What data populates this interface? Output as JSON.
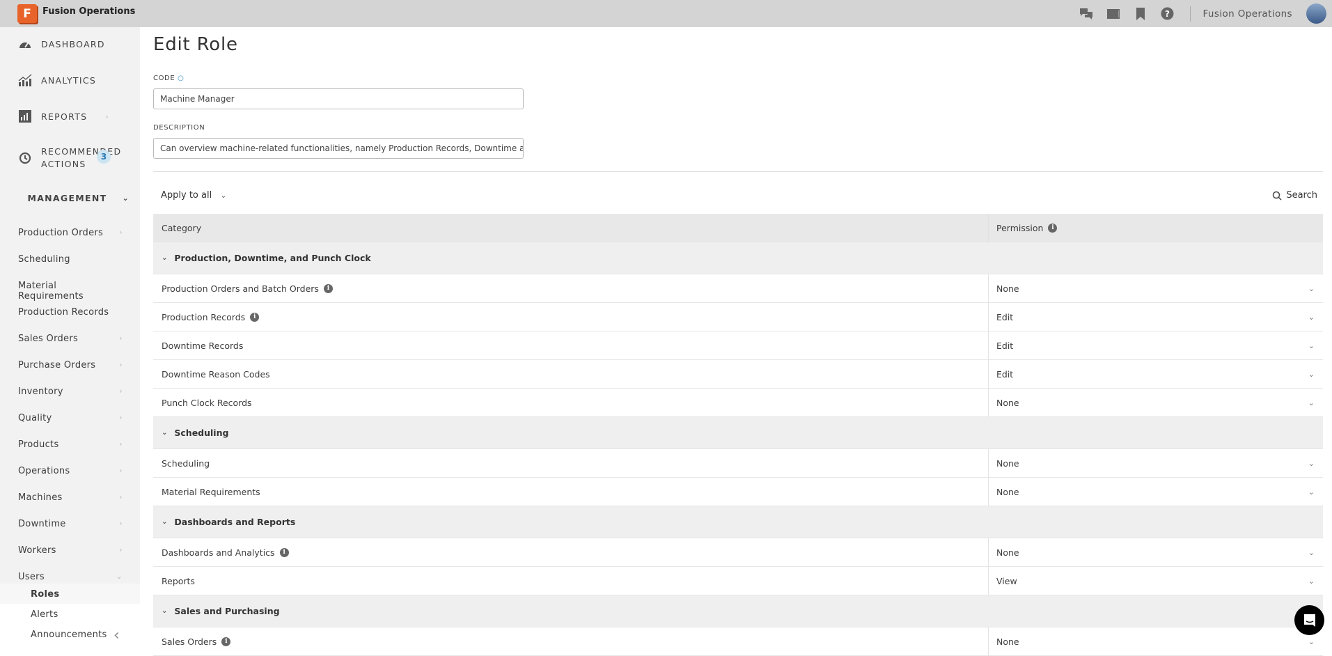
{
  "app": {
    "name": "Fusion Operations",
    "logo_letter": "F",
    "user_org": "Fusion Operations"
  },
  "topbar_icons": [
    "chat-icon",
    "tablet-icon",
    "bookmark-icon",
    "help-icon"
  ],
  "sidebar": {
    "main": [
      {
        "label": "DASHBOARD"
      },
      {
        "label": "ANALYTICS"
      },
      {
        "label": "REPORTS"
      },
      {
        "label": "RECOMMENDED",
        "label2": "ACTIONS",
        "badge": "3"
      },
      {
        "label": "MANAGEMENT"
      }
    ],
    "sub": [
      "Production Orders",
      "Scheduling",
      "Material Requirements",
      "Production Records",
      "Sales Orders",
      "Purchase Orders",
      "Inventory",
      "Quality",
      "Products",
      "Operations",
      "Machines",
      "Downtime",
      "Workers",
      "Users"
    ],
    "users_sub": [
      "Roles",
      "Alerts",
      "Announcements"
    ]
  },
  "page": {
    "title": "Edit Role",
    "code_label": "CODE",
    "code_value": "Machine Manager",
    "description_label": "DESCRIPTION",
    "description_value": "Can overview machine-related functionalities, namely Production Records, Downtime and Maintenance",
    "apply_to_all": "Apply to all",
    "search": "Search"
  },
  "table": {
    "headers": {
      "category": "Category",
      "permission": "Permission"
    },
    "groups": [
      {
        "name": "Production, Downtime, and Punch Clock",
        "rows": [
          {
            "name": "Production Orders and Batch Orders",
            "info": true,
            "permission": "None"
          },
          {
            "name": "Production Records",
            "info": true,
            "permission": "Edit"
          },
          {
            "name": "Downtime Records",
            "info": false,
            "permission": "Edit"
          },
          {
            "name": "Downtime Reason Codes",
            "info": false,
            "permission": "Edit"
          },
          {
            "name": "Punch Clock Records",
            "info": false,
            "permission": "None"
          }
        ]
      },
      {
        "name": "Scheduling",
        "rows": [
          {
            "name": "Scheduling",
            "info": false,
            "permission": "None"
          },
          {
            "name": "Material Requirements",
            "info": false,
            "permission": "None"
          }
        ]
      },
      {
        "name": "Dashboards and Reports",
        "rows": [
          {
            "name": "Dashboards and Analytics",
            "info": true,
            "permission": "None"
          },
          {
            "name": "Reports",
            "info": false,
            "permission": "View"
          }
        ]
      },
      {
        "name": "Sales and Purchasing",
        "rows": [
          {
            "name": "Sales Orders",
            "info": true,
            "permission": "None"
          }
        ]
      }
    ]
  },
  "colors": {
    "brand": "#e8632a",
    "topbar": "#d4d4d4",
    "sidebar": "#f2f2f2",
    "badge": "#cde5f2"
  }
}
